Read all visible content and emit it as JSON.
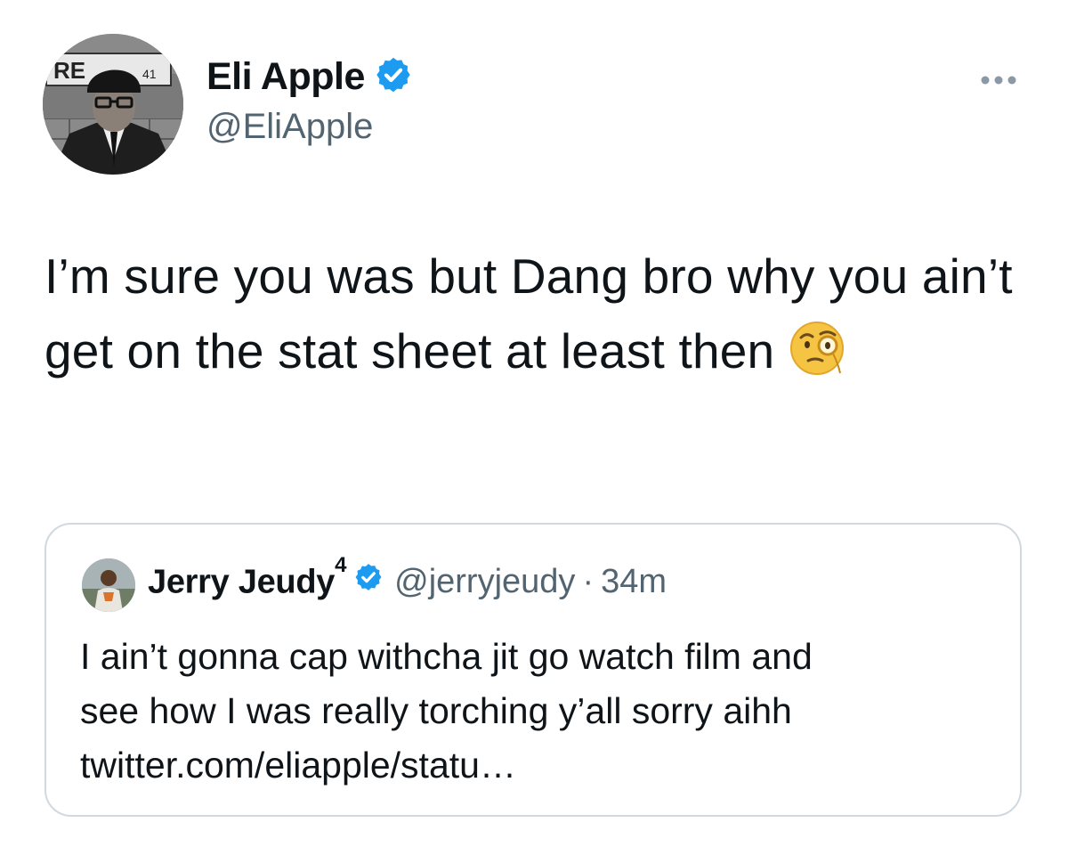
{
  "tweet": {
    "author": {
      "name": "Eli Apple",
      "handle": "@EliApple",
      "avatar_sign_text": "RE 41"
    },
    "text": "I’m sure you was but Dang bro why you ain’t get on the stat sheet at least then",
    "emoji": "face-with-monocle",
    "more_icon": "more-horizontal-icon"
  },
  "quote": {
    "author": {
      "name": "Jerry Jeudy",
      "name_superscript": "4",
      "handle": "@jerryjeudy",
      "separator": "·",
      "time": "34m"
    },
    "lines": [
      "I ain’t gonna cap withcha jit go watch film and",
      "see how I was really torching y’all sorry aihh",
      "twitter.com/eliapple/statu…"
    ]
  },
  "colors": {
    "verified_blue": "#1d9bf0",
    "secondary_text": "#536471",
    "border": "#cfd9de",
    "text": "#0f1419"
  }
}
